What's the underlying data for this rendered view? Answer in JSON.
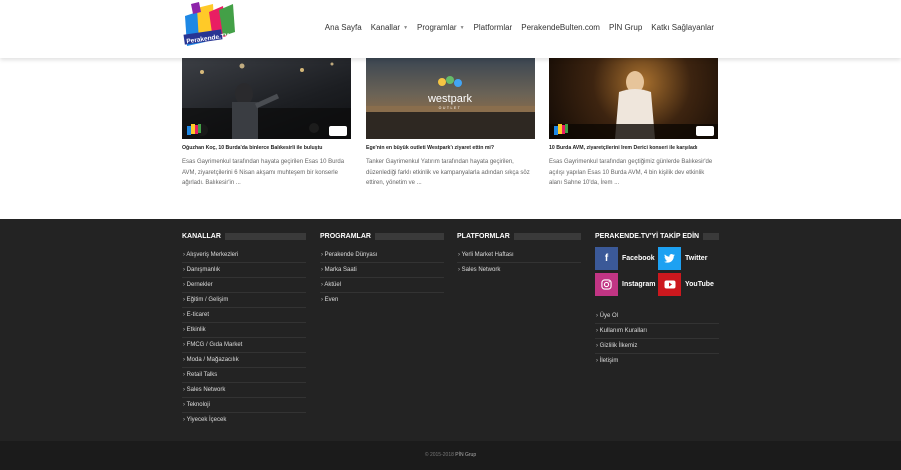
{
  "header": {
    "logo_text": "Perakende.TV",
    "nav": [
      {
        "label": "Ana Sayfa",
        "dropdown": false
      },
      {
        "label": "Kanallar",
        "dropdown": true
      },
      {
        "label": "Programlar",
        "dropdown": true
      },
      {
        "label": "Platformlar",
        "dropdown": false
      },
      {
        "label": "PerakendeBulten.com",
        "dropdown": false
      },
      {
        "label": "PİN Grup",
        "dropdown": false
      },
      {
        "label": "Katkı Sağlayanlar",
        "dropdown": false
      }
    ]
  },
  "cards": [
    {
      "title": "Oğuzhan Koç, 10 Burda'da binlerce Balıkesirli ile buluştu",
      "text": "Esas Gayrimenkul tarafından hayata geçirilen Esas 10 Burda AVM, ziyaretçilerini 6 Nisan akşamı muhteşem bir konserle ağırladı. Balıkesir'in ..."
    },
    {
      "title": "Ege'nin en büyük outleti Westpark'ı ziyaret ettin mi?",
      "text": "Tanker Gayrimenkul Yatırım tarafından hayata geçirilen, düzenlediği farklı etkinlik ve kampanyalarla adından sıkça söz ettiren, yönetim ve ..."
    },
    {
      "title": "10 Burda AVM, ziyaretçilerini İrem Derici konseri ile karşıladı",
      "text": "Esas Gayrimenkul tarafından geçtiğimiz günlerde Balıkesir'de açılışı yapılan Esas 10 Burda AVM, 4 bin kişilik dev etkinlik alanı Sahne 10'da, İrem ..."
    }
  ],
  "westpark": {
    "brand": "westpark",
    "sub": "OUTLET"
  },
  "footer": {
    "kanallar": {
      "heading": "KANALLAR",
      "items": [
        "Alışveriş Merkezleri",
        "Danışmanlık",
        "Dernekler",
        "Eğitim / Gelişim",
        "E-ticaret",
        "Etkinlik",
        "FMCG / Gıda Market",
        "Moda / Mağazacılık",
        "Retail Talks",
        "Sales Network",
        "Teknoloji",
        "Yiyecek İçecek"
      ]
    },
    "programlar": {
      "heading": "PROGRAMLAR",
      "items": [
        "Perakende Dünyası",
        "Marka Saati",
        "Aktüel",
        "Even"
      ]
    },
    "platformlar": {
      "heading": "PLATFORMLAR",
      "items": [
        "Yerli Market Haftası",
        "Sales Network"
      ]
    },
    "takip": {
      "heading": "PERAKENDE.TV'Yİ TAKİP EDİN",
      "social": [
        {
          "label": "Facebook",
          "icon": "facebook-icon",
          "color": "#3b5998",
          "glyph": "f"
        },
        {
          "label": "Twitter",
          "icon": "twitter-icon",
          "color": "#1da1f2",
          "glyph": "t"
        },
        {
          "label": "Instagram",
          "icon": "instagram-icon",
          "color": "#c13584",
          "glyph": "◎"
        },
        {
          "label": "YouTube",
          "icon": "youtube-icon",
          "color": "#cc181e",
          "glyph": "▶"
        }
      ],
      "links": [
        "Üye Ol",
        "Kullanım Kuralları",
        "Gizlilik İlkemiz",
        "İletişim"
      ]
    },
    "copyright": "© 2015-2018",
    "copyright_owner": "PİN Grup"
  }
}
